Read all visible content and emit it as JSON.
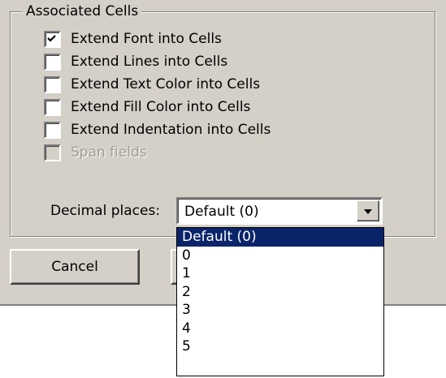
{
  "group": {
    "title": "Associated Cells"
  },
  "checkboxes": [
    {
      "label": "Extend Font into Cells",
      "checked": true,
      "enabled": true
    },
    {
      "label": "Extend Lines into Cells",
      "checked": false,
      "enabled": true
    },
    {
      "label": "Extend Text Color into Cells",
      "checked": false,
      "enabled": true
    },
    {
      "label": "Extend Fill Color into Cells",
      "checked": false,
      "enabled": true
    },
    {
      "label": "Extend Indentation into Cells",
      "checked": false,
      "enabled": true
    },
    {
      "label": "Span fields",
      "checked": false,
      "enabled": false
    }
  ],
  "decimal": {
    "label": "Decimal places:",
    "value": "Default  (0)",
    "options": [
      "Default  (0)",
      "0",
      "1",
      "2",
      "3",
      "4",
      "5"
    ],
    "selected_index": 0
  },
  "buttons": {
    "cancel_label": "Cancel"
  }
}
